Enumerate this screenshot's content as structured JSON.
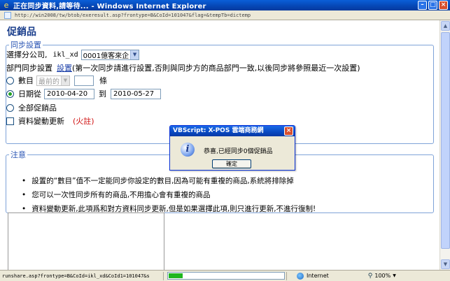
{
  "window": {
    "title": "正在同步資料,請等待... - Windows Internet Explorer",
    "address": "http://win2008/tw/btob/exeresult.asp?frontype=B&CoId=101047&flag=&tempTb=dictemp"
  },
  "page": {
    "title": "促銷品",
    "sync_section": {
      "legend": "同步設置",
      "branch_label": "選擇分公司,",
      "user_code": "ikl_xd",
      "branch_value": "0001億客來企",
      "dept_prefix": "部門同步設置",
      "dept_link": "設置",
      "dept_note": "(第一次同步請進行設置,否則與同步方的商品部門一致,以後同步將參照最近一次設置)",
      "count_label": "數目",
      "count_select": "最前的",
      "count_input": "",
      "count_unit": "條",
      "date_from_label": "日期從",
      "date_from": "2010-04-20",
      "date_to_label": "到",
      "date_to": "2010-05-27",
      "all_label": "全部促銷品",
      "change_label": "資料變動更新",
      "change_note": "(火註)"
    },
    "notes_section": {
      "legend": "注意",
      "items": [
        "設置的“數目”值不一定能同步你設定的數目,因為可能有重複的商品,系統將排除掉",
        "您可以一次性同步所有的商品,不用擔心會有重複的商品",
        "資料變動更新,此項爲和對方資料同步更新,但是如果選擇此項,則只進行更新,不進行復制!"
      ]
    }
  },
  "dialog": {
    "title": "VBScript: X-POS 雲端商務網",
    "message": "恭喜,已經同步0個促銷品",
    "ok_label": "確定"
  },
  "statusbar": {
    "text": "runshare.asp?frontype=B&CoId=ikl_xd&CoId1=101047&s",
    "progress": 0.12,
    "zone": "Internet",
    "zoom": "100%"
  },
  "colors": {
    "accent": "#2b56b4",
    "title_blue": "#1a3e8c",
    "note_red": "#d01010",
    "progress_green": "#1fb61f"
  }
}
